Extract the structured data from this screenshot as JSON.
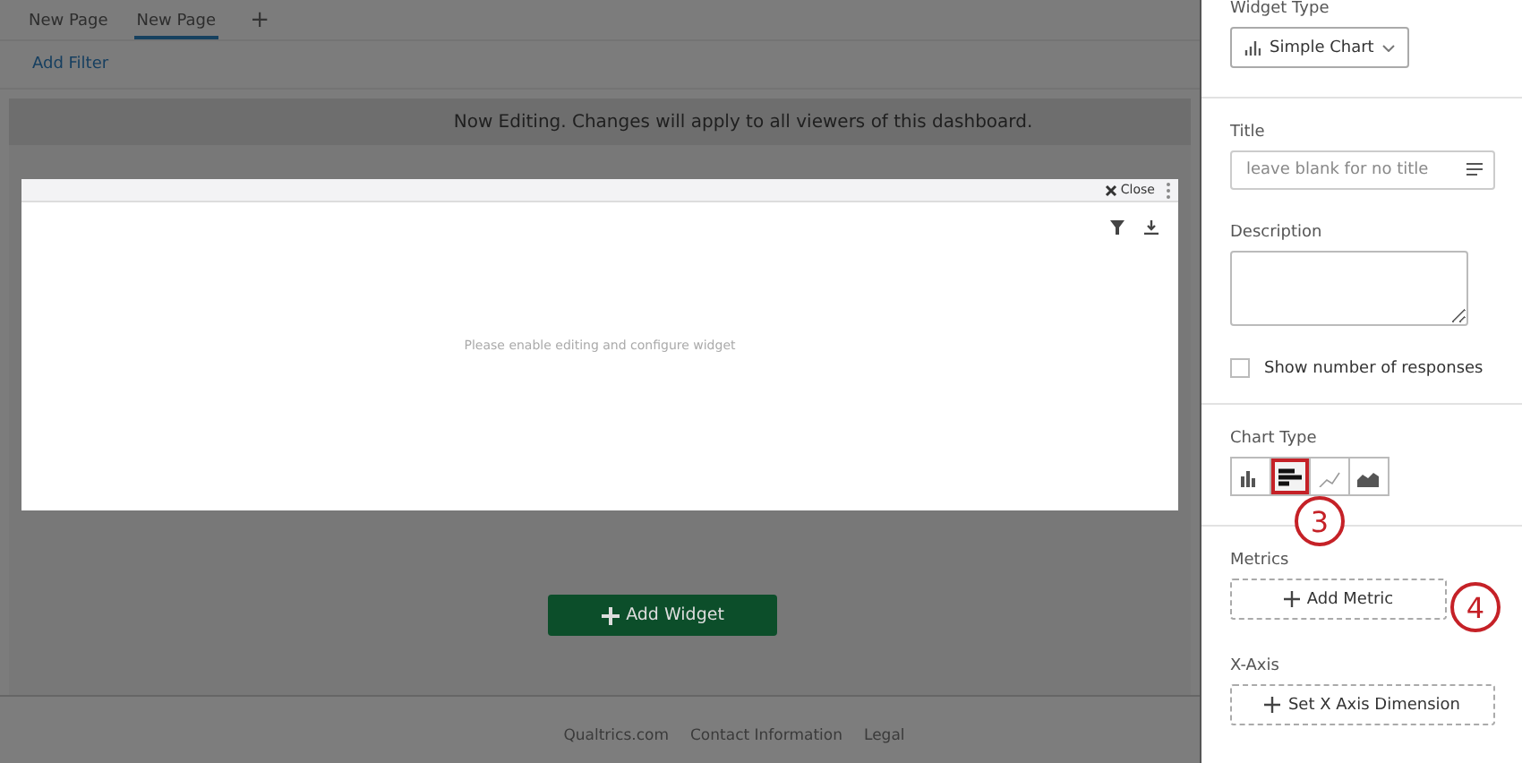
{
  "tabs": [
    {
      "label": "New Page",
      "selected": false
    },
    {
      "label": "New Page",
      "selected": true
    }
  ],
  "add_tab": "+",
  "filter_link": "Add Filter",
  "banner": "Now Editing. Changes will apply to all viewers of this dashboard.",
  "widget": {
    "close": "Close",
    "message": "Please enable editing and configure widget"
  },
  "add_widget": "Add Widget",
  "footer": [
    "Qualtrics.com",
    "Contact Information",
    "Legal"
  ],
  "panel": {
    "widget_type_label": "Widget Type",
    "widget_type": "Simple Chart",
    "title_label": "Title",
    "title_placeholder": "leave blank for no title",
    "description_label": "Description",
    "show_responses": {
      "label": "Show number of responses",
      "checked": false
    },
    "chart_type_label": "Chart Type",
    "chart_types": [
      {
        "kind": "column",
        "selected": false,
        "highlighted": false
      },
      {
        "kind": "bar",
        "selected": true,
        "highlighted": true
      },
      {
        "kind": "line",
        "selected": false,
        "highlighted": false
      },
      {
        "kind": "area",
        "selected": false,
        "highlighted": false
      }
    ],
    "chart_type_marker": "3",
    "metrics_label": "Metrics",
    "metrics_marker": "4",
    "add_metric": "Add Metric",
    "xaxis_label": "X-Axis",
    "set_xaxis": "Set X Axis Dimension"
  }
}
